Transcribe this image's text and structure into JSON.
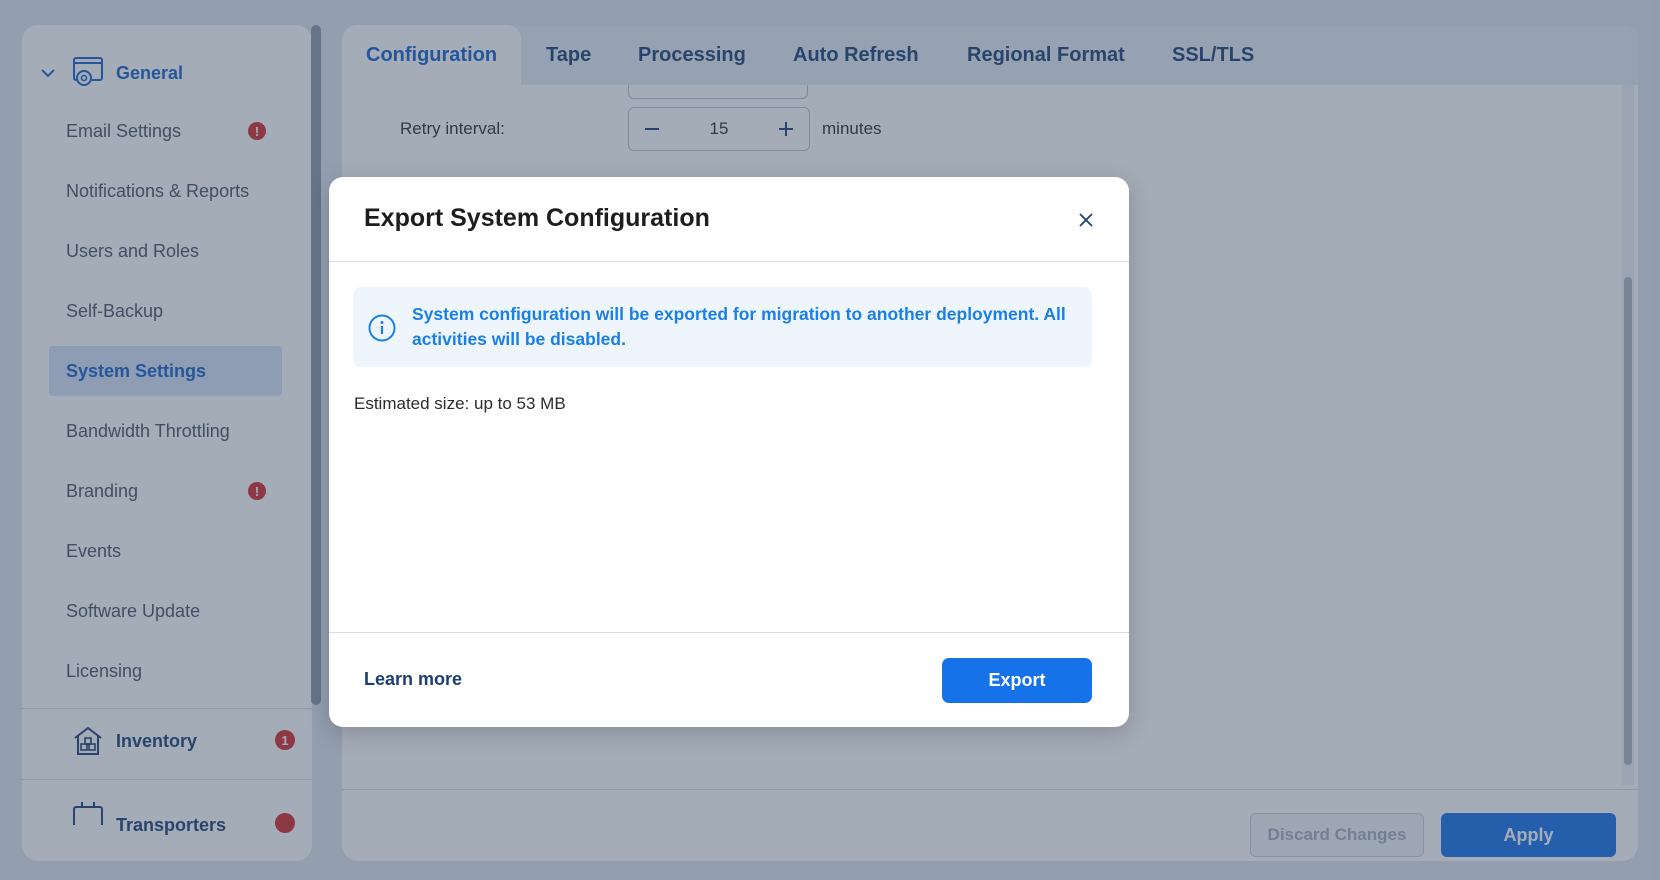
{
  "sidebar": {
    "section_title": "General",
    "items": [
      {
        "label": "Email Settings",
        "alert": "!"
      },
      {
        "label": "Notifications & Reports"
      },
      {
        "label": "Users and Roles"
      },
      {
        "label": "Self-Backup"
      },
      {
        "label": "System Settings",
        "active": true
      },
      {
        "label": "Bandwidth Throttling"
      },
      {
        "label": "Branding",
        "alert": "!"
      },
      {
        "label": "Events"
      },
      {
        "label": "Software Update"
      },
      {
        "label": "Licensing"
      }
    ],
    "inventory": {
      "label": "Inventory",
      "badge": "1"
    },
    "transporters": {
      "label": "Transporters"
    }
  },
  "tabs": [
    {
      "label": "Configuration",
      "active": true
    },
    {
      "label": "Tape"
    },
    {
      "label": "Processing"
    },
    {
      "label": "Auto Refresh"
    },
    {
      "label": "Regional Format"
    },
    {
      "label": "SSL/TLS"
    }
  ],
  "settings": {
    "retry_label": "Retry interval:",
    "retry_value": "15",
    "retry_unit": "minutes"
  },
  "footer": {
    "discard_label": "Discard Changes",
    "apply_label": "Apply"
  },
  "modal": {
    "title": "Export System Configuration",
    "info_message": "System configuration will be exported for migration to another deployment. All activities will be disabled.",
    "estimated_size": "Estimated size: up to  53 MB",
    "learn_more_label": "Learn more",
    "export_label": "Export"
  },
  "colors": {
    "accent": "#1672e8",
    "link": "#1c3f73",
    "info_text": "#1a80e6",
    "alert": "#d42a2a"
  }
}
